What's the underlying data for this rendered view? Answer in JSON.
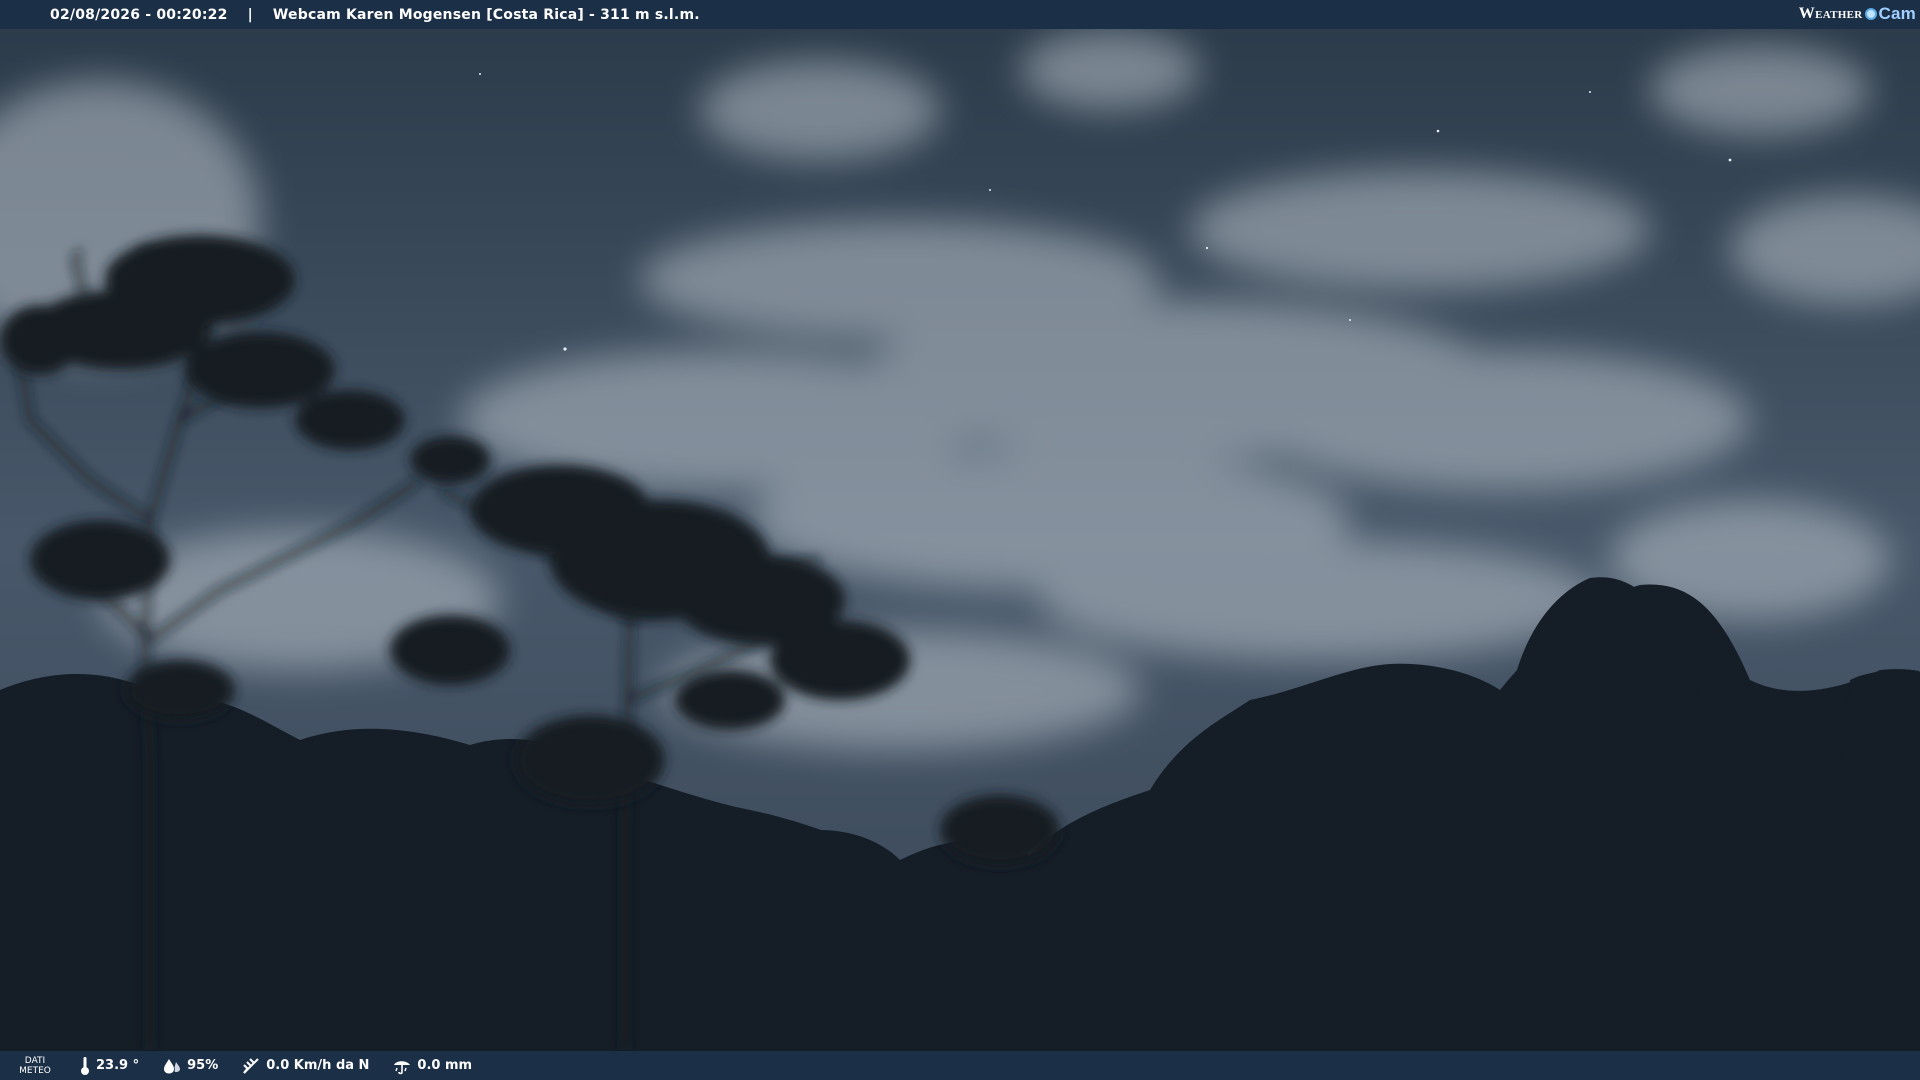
{
  "header": {
    "datetime": "02/08/2026 - 00:20:22",
    "separator": "|",
    "title": "Webcam Karen Mogensen [Costa Rica]  - 311 m s.l.m.",
    "logo": {
      "weather": "Weather",
      "cam": "Cam"
    }
  },
  "footer": {
    "dati_label": "DATI",
    "meteo_label": "METEO",
    "temperature": "23.9 °",
    "humidity": "95%",
    "wind": "0.0 Km/h da N",
    "rain": "0.0 mm",
    "icons": [
      "thermometer-icon",
      "humidity-icon",
      "wind-icon",
      "rain-icon"
    ]
  },
  "colors": {
    "bar_bg": "#1b2f47",
    "sky": "#3c4a58",
    "cloud": "#aeb6be",
    "foliage": "#141c26"
  }
}
